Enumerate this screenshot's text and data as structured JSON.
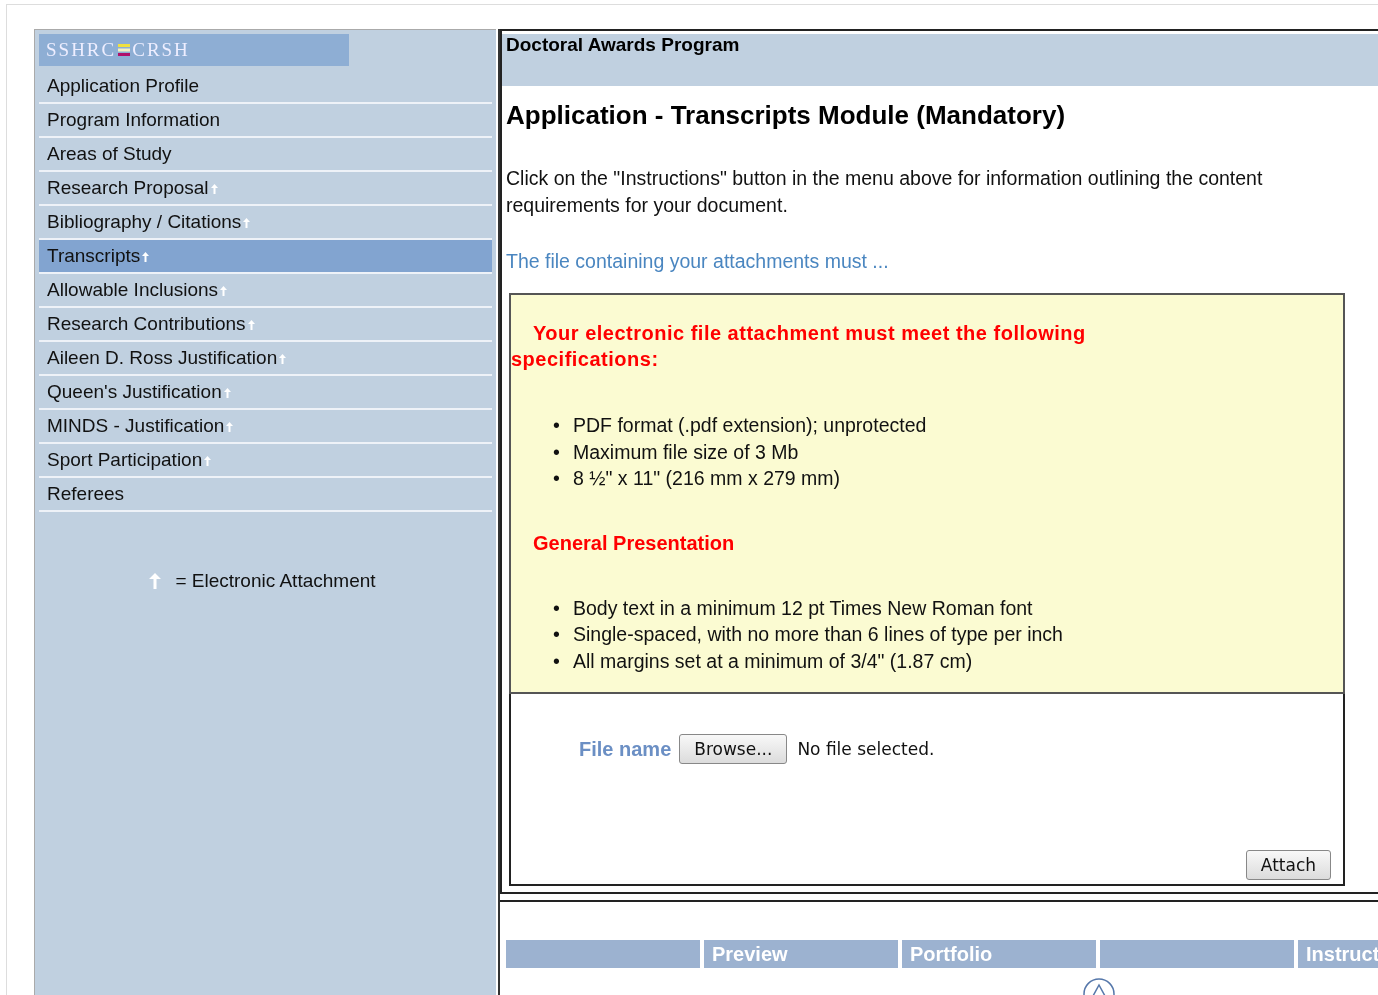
{
  "logo": {
    "left": "SSHRC",
    "right": "CRSH"
  },
  "sidebar": {
    "items": [
      {
        "label": "Application Profile",
        "attachment": false,
        "selected": false
      },
      {
        "label": "Program Information",
        "attachment": false,
        "selected": false
      },
      {
        "label": "Areas of Study",
        "attachment": false,
        "selected": false
      },
      {
        "label": "Research Proposal",
        "attachment": true,
        "selected": false
      },
      {
        "label": "Bibliography / Citations",
        "attachment": true,
        "selected": false
      },
      {
        "label": "Transcripts",
        "attachment": true,
        "selected": true
      },
      {
        "label": "Allowable Inclusions",
        "attachment": true,
        "selected": false
      },
      {
        "label": "Research Contributions",
        "attachment": true,
        "selected": false
      },
      {
        "label": "Aileen D. Ross Justification",
        "attachment": true,
        "selected": false
      },
      {
        "label": "Queen's Justification",
        "attachment": true,
        "selected": false
      },
      {
        "label": "MINDS - Justification",
        "attachment": true,
        "selected": false
      },
      {
        "label": "Sport Participation",
        "attachment": true,
        "selected": false
      },
      {
        "label": "Referees",
        "attachment": false,
        "selected": false
      }
    ],
    "legend": "= Electronic Attachment"
  },
  "header": {
    "program": "Doctoral Awards Program"
  },
  "content": {
    "title": "Application - Transcripts Module (Mandatory)",
    "intro": "Click on the \"Instructions\" button in the menu above for information outlining the content requirements for your document.",
    "link": "The file containing your attachments must ...",
    "specs": {
      "heading": "Your electronic file attachment must meet the following specifications:",
      "items": [
        {
          "bullet": "•",
          "text": "PDF format (.pdf extension); unprotected"
        },
        {
          "bullet": "•",
          "text": "Maximum file size of 3 Mb"
        },
        {
          "bullet": "•",
          "text": "8 ½\" x 11\" (216 mm x 279 mm)"
        }
      ],
      "subheading": "General Presentation",
      "presentation": [
        {
          "bullet": "•",
          "text": "Body text in a minimum 12 pt Times New Roman font"
        },
        {
          "bullet": "•",
          "text": "Single-spaced, with no more than 6 lines of type per inch"
        },
        {
          "bullet": "•",
          "text": "All margins set at a minimum of 3/4\" (1.87 cm)"
        }
      ]
    },
    "upload": {
      "label": "File name",
      "browse": "Browse...",
      "status": "No file selected.",
      "attach": "Attach"
    }
  },
  "bottom_tabs": [
    {
      "kind": "blank"
    },
    {
      "kind": "labeled",
      "label": "Preview"
    },
    {
      "kind": "labeled",
      "label": "Portfolio"
    },
    {
      "kind": "blank"
    },
    {
      "kind": "labeled",
      "label": "Instruct"
    }
  ]
}
